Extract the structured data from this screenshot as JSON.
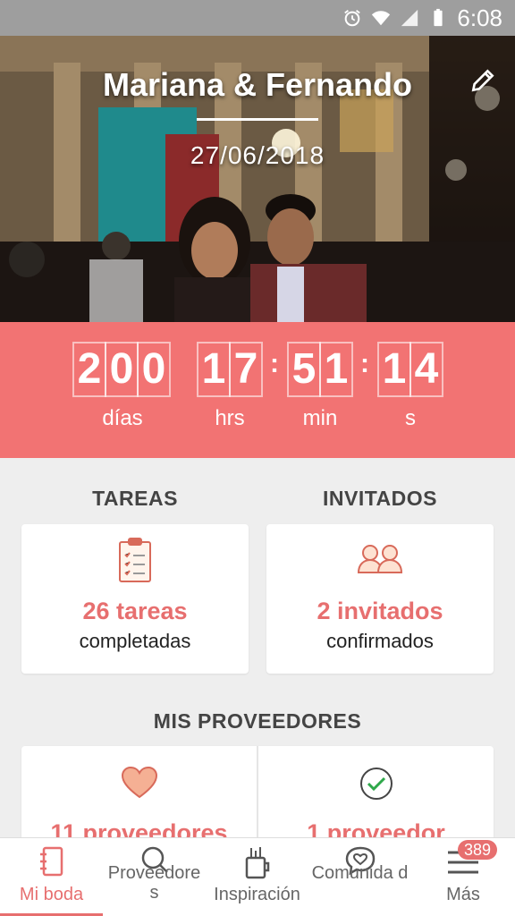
{
  "status_bar": {
    "time": "6:08"
  },
  "hero": {
    "couple_names": "Mariana & Fernando",
    "wedding_date": "27/06/2018"
  },
  "countdown": {
    "days": "200",
    "hours": "17",
    "minutes": "51",
    "seconds": "14",
    "days_label": "días",
    "hours_label": "hrs",
    "minutes_label": "min",
    "seconds_label": "s"
  },
  "tasks": {
    "title": "TAREAS",
    "count": "26 tareas",
    "sub": "completadas"
  },
  "guests": {
    "title": "INVITADOS",
    "count": "2 invitados",
    "sub": "confirmados"
  },
  "providers": {
    "title": "MIS PROVEEDORES",
    "left_count": "11 proveedores",
    "right_count": "1 proveedor"
  },
  "nav": {
    "items": [
      {
        "label": "Mi boda",
        "icon": "notebook-icon",
        "active": true
      },
      {
        "label": "Proveedore s",
        "icon": "search-icon"
      },
      {
        "label": "Inspiración",
        "icon": "inspiration-icon"
      },
      {
        "label": "Comunida d",
        "icon": "community-icon"
      },
      {
        "label": "Más",
        "icon": "menu-icon"
      }
    ],
    "badge": "389"
  },
  "colors": {
    "accent": "#f27373",
    "accent_text": "#e76f6f"
  }
}
